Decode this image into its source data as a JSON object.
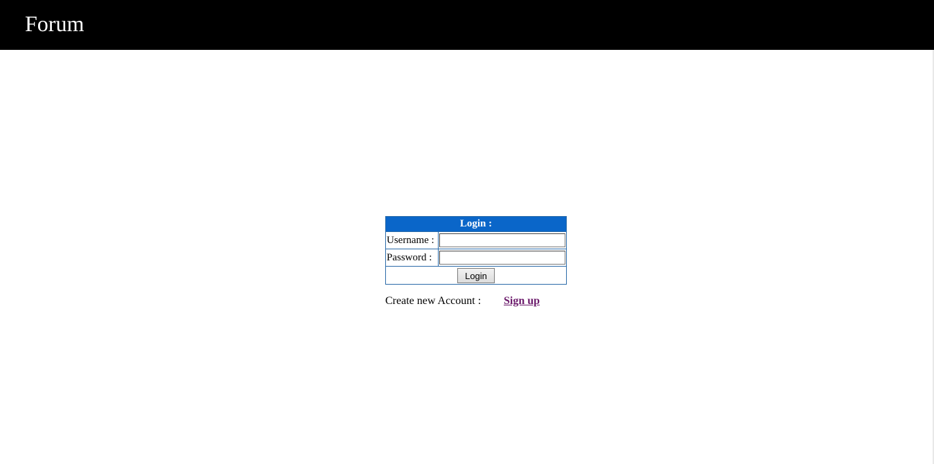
{
  "header": {
    "title": "Forum"
  },
  "login": {
    "heading": "Login :",
    "username_label": "Username :",
    "username_value": "",
    "password_label": "Password :",
    "password_value": "",
    "button_label": "Login"
  },
  "signup": {
    "prompt": "Create new Account :",
    "link_label": "Sign up"
  },
  "colors": {
    "header_bg": "#000000",
    "login_header_bg": "#0a66c9",
    "border": "#2a6aa8",
    "link": "#6b1a6b"
  }
}
